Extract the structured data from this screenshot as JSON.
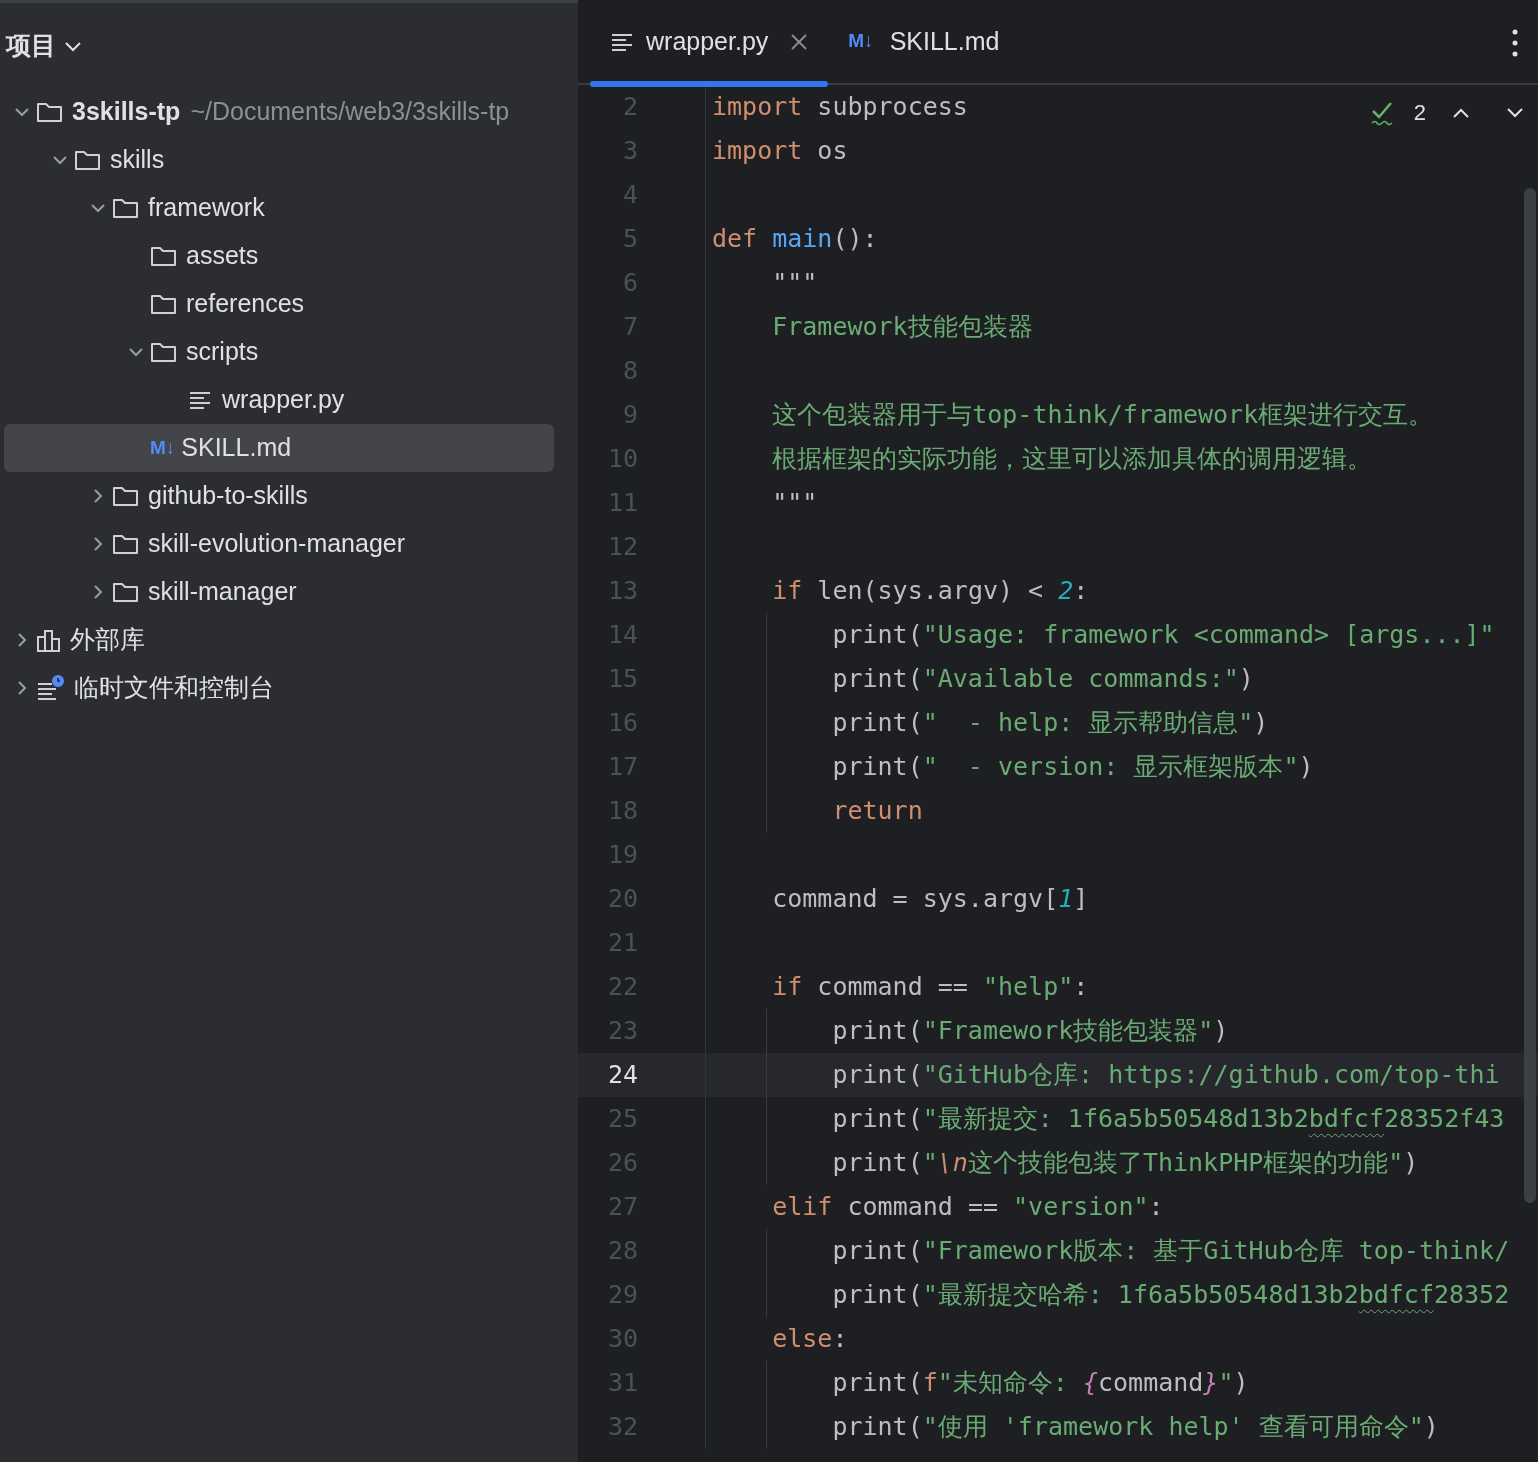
{
  "sidebar": {
    "title": "项目",
    "tree": [
      {
        "name": "3skills-tp",
        "path": "~/Documents/web3/3skills-tp",
        "kind": "folder",
        "expanded": true,
        "selected": false,
        "children": [
          {
            "name": "skills",
            "kind": "folder",
            "expanded": true,
            "selected": false,
            "children": [
              {
                "name": "framework",
                "kind": "folder",
                "expanded": true,
                "selected": false,
                "children": [
                  {
                    "name": "assets",
                    "kind": "folder",
                    "selected": false
                  },
                  {
                    "name": "references",
                    "kind": "folder",
                    "selected": false
                  },
                  {
                    "name": "scripts",
                    "kind": "folder",
                    "expanded": true,
                    "selected": false,
                    "children": [
                      {
                        "name": "wrapper.py",
                        "kind": "python",
                        "selected": false
                      }
                    ]
                  },
                  {
                    "name": "SKILL.md",
                    "kind": "markdown",
                    "badge": "M↓",
                    "selected": true
                  }
                ]
              },
              {
                "name": "github-to-skills",
                "kind": "folder",
                "expanded": false,
                "selected": false
              },
              {
                "name": "skill-evolution-manager",
                "kind": "folder",
                "expanded": false,
                "selected": false
              },
              {
                "name": "skill-manager",
                "kind": "folder",
                "expanded": false,
                "selected": false
              }
            ]
          }
        ]
      },
      {
        "name": "外部库",
        "kind": "library",
        "expanded": false,
        "selected": false
      },
      {
        "name": "临时文件和控制台",
        "kind": "scratches",
        "expanded": false,
        "selected": false
      }
    ]
  },
  "tabs": [
    {
      "label": "wrapper.py",
      "kind": "python",
      "selected": true,
      "closable": true
    },
    {
      "label": "SKILL.md",
      "kind": "markdown",
      "badge": "M↓",
      "selected": false,
      "closable": false
    }
  ],
  "inspections": {
    "count": "2"
  },
  "editor": {
    "lines": [
      {
        "number": "2",
        "current": false,
        "tokens": [
          {
            "kind": "keyword",
            "text": "import"
          },
          {
            "kind": "plain",
            "text": " subprocess"
          }
        ]
      },
      {
        "number": "3",
        "current": false,
        "tokens": [
          {
            "kind": "keyword",
            "text": "import"
          },
          {
            "kind": "plain",
            "text": " os"
          }
        ]
      },
      {
        "number": "4",
        "current": false
      },
      {
        "number": "5",
        "current": false,
        "tokens": [
          {
            "kind": "keyword",
            "text": "def "
          },
          {
            "kind": "function",
            "text": "main"
          },
          {
            "kind": "plain",
            "text": "():"
          }
        ]
      },
      {
        "number": "6",
        "current": false,
        "tokens": [
          {
            "kind": "plain",
            "text": "    \"\"\""
          }
        ]
      },
      {
        "number": "7",
        "current": false,
        "tokens": [
          {
            "kind": "string",
            "text": "    Framework技能包装器"
          }
        ]
      },
      {
        "number": "8",
        "current": false
      },
      {
        "number": "9",
        "current": false,
        "tokens": [
          {
            "kind": "string",
            "text": "    这个包装器用于与top-think/framework框架进行交互。"
          }
        ]
      },
      {
        "number": "10",
        "current": false,
        "tokens": [
          {
            "kind": "string",
            "text": "    根据框架的实际功能，这里可以添加具体的调用逻辑。"
          }
        ]
      },
      {
        "number": "11",
        "current": false,
        "tokens": [
          {
            "kind": "plain",
            "text": "    \"\"\""
          }
        ]
      },
      {
        "number": "12",
        "current": false
      },
      {
        "number": "13",
        "current": false,
        "tokens": [
          {
            "kind": "keyword",
            "text": "    if"
          },
          {
            "kind": "plain",
            "text": " len(sys.argv) < "
          },
          {
            "kind": "number",
            "text": "2"
          },
          {
            "kind": "plain",
            "text": ":"
          }
        ]
      },
      {
        "number": "14",
        "current": false,
        "tokens": [
          {
            "kind": "plain",
            "text": "        print("
          },
          {
            "kind": "string",
            "text": "\"Usage: framework <command> [args...]\""
          }
        ]
      },
      {
        "number": "15",
        "current": false,
        "tokens": [
          {
            "kind": "plain",
            "text": "        print("
          },
          {
            "kind": "string",
            "text": "\"Available commands:\""
          },
          {
            "kind": "plain",
            "text": ")"
          }
        ]
      },
      {
        "number": "16",
        "current": false,
        "tokens": [
          {
            "kind": "plain",
            "text": "        print("
          },
          {
            "kind": "string",
            "text": "\"  - help: 显示帮助信息\""
          },
          {
            "kind": "plain",
            "text": ")"
          }
        ]
      },
      {
        "number": "17",
        "current": false,
        "tokens": [
          {
            "kind": "plain",
            "text": "        print("
          },
          {
            "kind": "string",
            "text": "\"  - version: 显示框架版本\""
          },
          {
            "kind": "plain",
            "text": ")"
          }
        ]
      },
      {
        "number": "18",
        "current": false,
        "tokens": [
          {
            "kind": "keyword",
            "text": "        return"
          }
        ]
      },
      {
        "number": "19",
        "current": false
      },
      {
        "number": "20",
        "current": false,
        "tokens": [
          {
            "kind": "plain",
            "text": "    command = sys.argv["
          },
          {
            "kind": "number",
            "text": "1"
          },
          {
            "kind": "plain",
            "text": "]"
          }
        ]
      },
      {
        "number": "21",
        "current": false
      },
      {
        "number": "22",
        "current": false,
        "tokens": [
          {
            "kind": "keyword",
            "text": "    if"
          },
          {
            "kind": "plain",
            "text": " command == "
          },
          {
            "kind": "string",
            "text": "\"help\""
          },
          {
            "kind": "plain",
            "text": ":"
          }
        ]
      },
      {
        "number": "23",
        "current": false,
        "tokens": [
          {
            "kind": "plain",
            "text": "        print("
          },
          {
            "kind": "string",
            "text": "\"Framework技能包装器\""
          },
          {
            "kind": "plain",
            "text": ")"
          }
        ]
      },
      {
        "number": "24",
        "current": true,
        "tokens": [
          {
            "kind": "plain",
            "text": "        print("
          },
          {
            "kind": "string",
            "text": "\"GitHub仓库: https://github.com/top-thi"
          }
        ]
      },
      {
        "number": "25",
        "current": false,
        "tokens": [
          {
            "kind": "plain",
            "text": "        print("
          },
          {
            "kind": "string",
            "text": "\"最新提交: 1f6a5b50548d13b2"
          },
          {
            "kind": "typo",
            "text": "bdfcf"
          },
          {
            "kind": "string",
            "text": "28352f43"
          }
        ]
      },
      {
        "number": "26",
        "current": false,
        "tokens": [
          {
            "kind": "plain",
            "text": "        print("
          },
          {
            "kind": "string",
            "text": "\""
          },
          {
            "kind": "escape",
            "text": "\\n"
          },
          {
            "kind": "string",
            "text": "这个技能包装了ThinkPHP框架的功能\""
          },
          {
            "kind": "plain",
            "text": ")"
          }
        ]
      },
      {
        "number": "27",
        "current": false,
        "tokens": [
          {
            "kind": "keyword",
            "text": "    elif"
          },
          {
            "kind": "plain",
            "text": " command == "
          },
          {
            "kind": "string",
            "text": "\"version\""
          },
          {
            "kind": "plain",
            "text": ":"
          }
        ]
      },
      {
        "number": "28",
        "current": false,
        "tokens": [
          {
            "kind": "plain",
            "text": "        print("
          },
          {
            "kind": "string",
            "text": "\"Framework版本: 基于GitHub仓库 top-think/"
          }
        ]
      },
      {
        "number": "29",
        "current": false,
        "tokens": [
          {
            "kind": "plain",
            "text": "        print("
          },
          {
            "kind": "string",
            "text": "\"最新提交哈希: 1f6a5b50548d13b2"
          },
          {
            "kind": "typo",
            "text": "bdfcf"
          },
          {
            "kind": "string",
            "text": "28352"
          }
        ]
      },
      {
        "number": "30",
        "current": false,
        "tokens": [
          {
            "kind": "keyword",
            "text": "    else"
          },
          {
            "kind": "plain",
            "text": ":"
          }
        ]
      },
      {
        "number": "31",
        "current": false,
        "tokens": [
          {
            "kind": "plain",
            "text": "        print("
          },
          {
            "kind": "keyword",
            "text": "f"
          },
          {
            "kind": "string",
            "text": "\"未知命令: "
          },
          {
            "kind": "brace",
            "text": "{"
          },
          {
            "kind": "plain",
            "text": "command"
          },
          {
            "kind": "brace",
            "text": "}"
          },
          {
            "kind": "string",
            "text": "\""
          },
          {
            "kind": "plain",
            "text": ")"
          }
        ]
      },
      {
        "number": "32",
        "current": false,
        "tokens": [
          {
            "kind": "plain",
            "text": "        print("
          },
          {
            "kind": "string",
            "text": "\"使用 'framework help' 查看可用命令\""
          },
          {
            "kind": "plain",
            "text": ")"
          }
        ]
      }
    ]
  }
}
